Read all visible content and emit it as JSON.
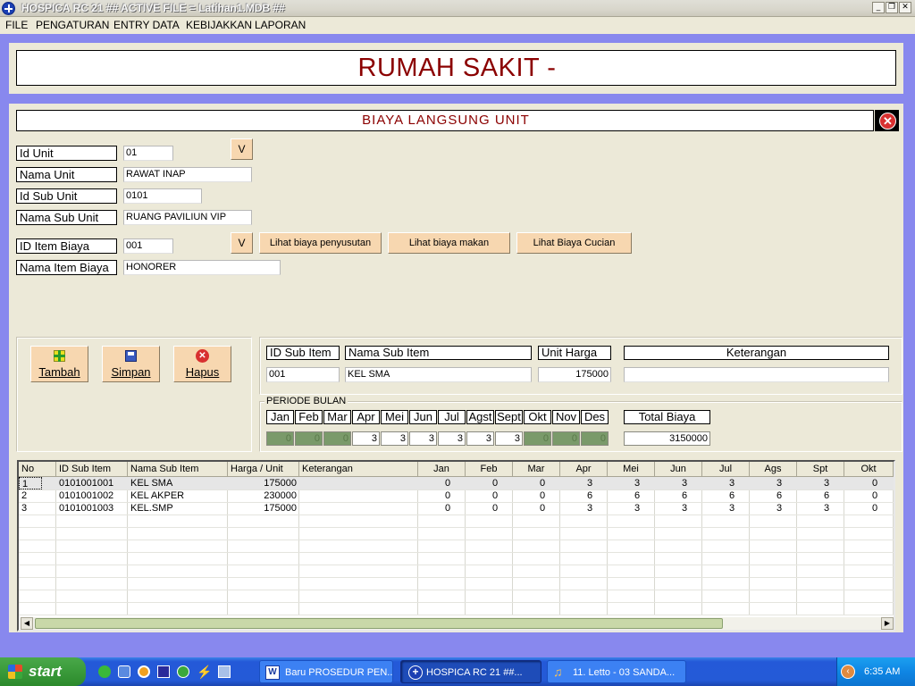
{
  "window": {
    "title": "HOSPICA RC 21 ## ACTIVE FILE = Latihan1.MDB ##"
  },
  "menu": [
    "FILE",
    "PENGATURAN",
    "ENTRY DATA",
    "KEBIJAKKAN",
    "LAPORAN"
  ],
  "header": {
    "title": "RUMAH SAKIT -"
  },
  "form": {
    "title": "BIAYA LANGSUNG UNIT",
    "id_unit_label": "Id Unit",
    "id_unit_value": "01",
    "nama_unit_label": "Nama Unit",
    "nama_unit_value": "RAWAT INAP",
    "id_sub_unit_label": "Id Sub Unit",
    "id_sub_unit_value": "0101",
    "nama_sub_unit_label": "Nama Sub Unit",
    "nama_sub_unit_value": "RUANG PAVILIUN VIP",
    "id_item_label": "ID Item Biaya",
    "id_item_value": "001",
    "nama_item_label": "Nama Item Biaya",
    "nama_item_value": "HONORER",
    "dropdown_label": "V",
    "btn_penyusutan": "Lihat biaya penyusutan",
    "btn_makan": "Lihat biaya makan",
    "btn_cucian": "Lihat Biaya Cucian"
  },
  "actions": {
    "tambah": "Tambah",
    "simpan": "Simpan",
    "hapus": "Hapus"
  },
  "subitem": {
    "id_label": "ID Sub Item",
    "nama_label": "Nama Sub Item",
    "harga_label": "Unit Harga",
    "ket_label": "Keterangan",
    "id_value": "001",
    "nama_value": "KEL SMA",
    "harga_value": "175000",
    "ket_value": ""
  },
  "periode": {
    "label": "PERIODE BULAN",
    "months": [
      "Jan",
      "Feb",
      "Mar",
      "Apr",
      "Mei",
      "Jun",
      "Jul",
      "Agst",
      "Sept",
      "Okt",
      "Nov",
      "Des"
    ],
    "values": [
      "0",
      "0",
      "0",
      "3",
      "3",
      "3",
      "3",
      "3",
      "3",
      "0",
      "0",
      "0"
    ],
    "total_label": "Total Biaya",
    "total_value": "3150000"
  },
  "grid": {
    "columns": [
      "No",
      "ID Sub Item",
      "Nama Sub Item",
      "Harga / Unit",
      "Keterangan",
      "Jan",
      "Feb",
      "Mar",
      "Apr",
      "Mei",
      "Jun",
      "Jul",
      "Ags",
      "Spt",
      "Okt"
    ],
    "rows": [
      [
        "1",
        "0101001001",
        "KEL SMA",
        "175000",
        "",
        "0",
        "0",
        "0",
        "3",
        "3",
        "3",
        "3",
        "3",
        "3",
        "0"
      ],
      [
        "2",
        "0101001002",
        "KEL AKPER",
        "230000",
        "",
        "0",
        "0",
        "0",
        "6",
        "6",
        "6",
        "6",
        "6",
        "6",
        "0"
      ],
      [
        "3",
        "0101001003",
        "KEL.SMP",
        "175000",
        "",
        "0",
        "0",
        "0",
        "3",
        "3",
        "3",
        "3",
        "3",
        "3",
        "0"
      ]
    ]
  },
  "taskbar": {
    "start": "start",
    "tasks": [
      "Baru PROSEDUR PEN...",
      "HOSPICA RC 21 ##...",
      "11. Letto - 03 SANDA..."
    ],
    "clock": "6:35 AM"
  },
  "colors": {
    "accent": "#8888EE",
    "title_red": "#8B0000",
    "button_peach": "#F7D7B0"
  }
}
